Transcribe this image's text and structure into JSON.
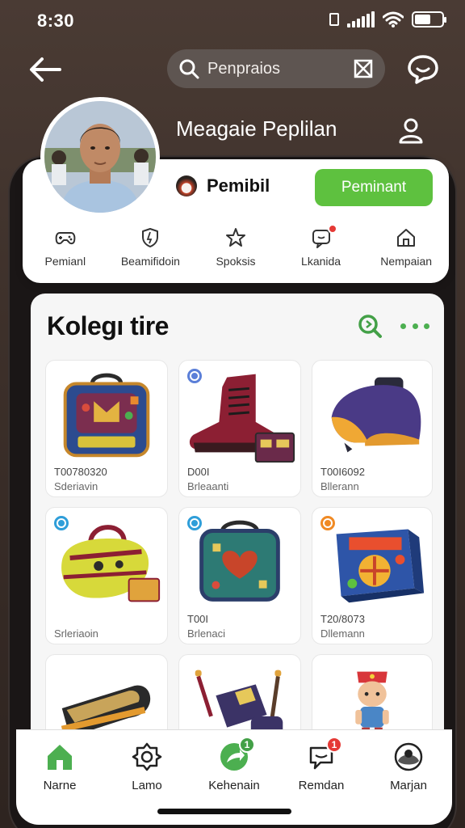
{
  "status_bar": {
    "time": "8:30"
  },
  "top_bar": {
    "search_text": "Penpraios"
  },
  "profile": {
    "name": "Meagaie Peplilan"
  },
  "profile_card": {
    "brand_name": "Pemibil",
    "primary_button": "Peminant",
    "quick_actions": [
      {
        "label": "Pemianl",
        "icon": "controller-icon"
      },
      {
        "label": "Beamifidoin",
        "icon": "shield-icon"
      },
      {
        "label": "Spoksis",
        "icon": "star-icon"
      },
      {
        "label": "Lkanida",
        "icon": "message-icon"
      },
      {
        "label": "Nempaian",
        "icon": "home-icon"
      }
    ]
  },
  "collection": {
    "title": "Kolegı tire",
    "items": [
      {
        "name": "backpack",
        "code": "T00780320",
        "sub": "Sderiavin",
        "badge_color": ""
      },
      {
        "name": "boot",
        "code": "D00I",
        "sub": "Brleaanti",
        "badge_color": "#5b7fd8"
      },
      {
        "name": "helmet",
        "code": "T00I6092",
        "sub": "Bllerann",
        "badge_color": ""
      },
      {
        "name": "duffel-bag",
        "code": "",
        "sub": "Srleriaoin",
        "badge_color": "#2f9ed9"
      },
      {
        "name": "lunch-bag",
        "code": "T00I",
        "sub": "Brlenaci",
        "badge_color": "#2f9ed9"
      },
      {
        "name": "game-box",
        "code": "T20/8073",
        "sub": "Dllemann",
        "badge_color": "#f08a24"
      },
      {
        "name": "tube",
        "code": "",
        "sub": "",
        "badge_color": ""
      },
      {
        "name": "cannon",
        "code": "",
        "sub": "",
        "badge_color": ""
      },
      {
        "name": "figure",
        "code": "",
        "sub": "",
        "badge_color": ""
      }
    ]
  },
  "bottom_nav": [
    {
      "label": "Narne",
      "icon": "home-icon",
      "badge": ""
    },
    {
      "label": "Lamo",
      "icon": "camera-icon",
      "badge": ""
    },
    {
      "label": "Kehenain",
      "icon": "share-icon",
      "badge": "1"
    },
    {
      "label": "Remdan",
      "icon": "chat-icon",
      "badge": "1"
    },
    {
      "label": "Marjan",
      "icon": "profile-icon",
      "badge": ""
    }
  ],
  "colors": {
    "accent_green": "#5ec13f",
    "badge_red": "#e53935",
    "badge_green": "#43a047"
  }
}
